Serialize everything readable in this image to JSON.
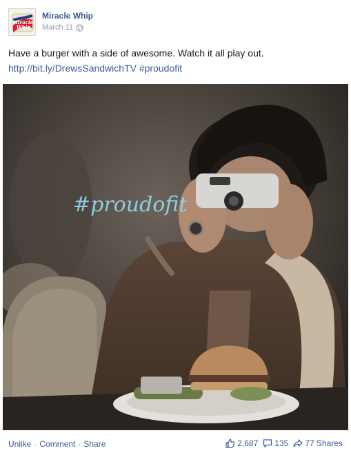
{
  "post": {
    "author": "Miracle Whip",
    "avatar_text": "Miracle Whip",
    "date": "March 11",
    "text": "Have a burger with a side of awesome. Watch it all play out.",
    "link": "http://bit.ly/DrewsSandwichTV",
    "hashtag": "#proudofit"
  },
  "photo": {
    "overlay_text": "#proudofit"
  },
  "footer": {
    "unlike": "Unlike",
    "comment": "Comment",
    "share": "Share",
    "separator": "·",
    "likes": "2,687",
    "comments": "135",
    "shares": "77 Shares"
  },
  "colors": {
    "link": "#3b5998",
    "meta": "#9197a3",
    "overlay": "#8fd3e8"
  }
}
